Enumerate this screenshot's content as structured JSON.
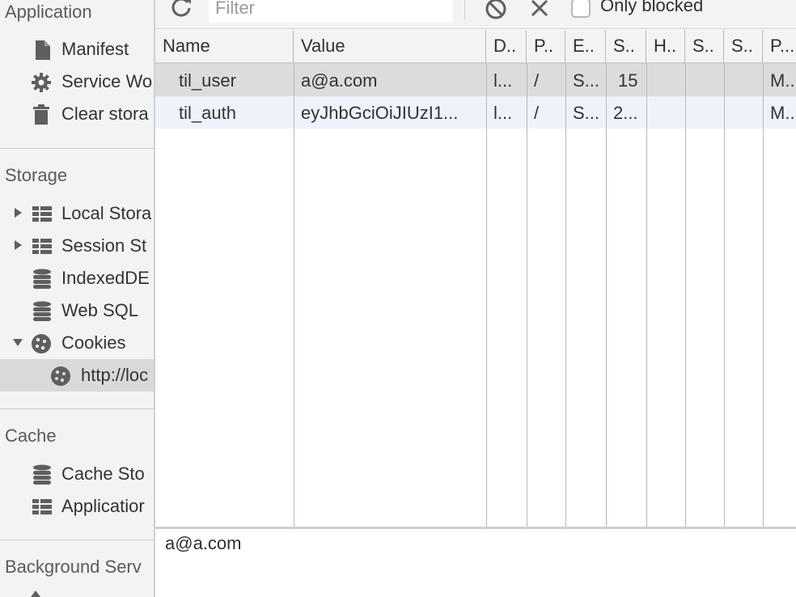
{
  "sidebar": {
    "application": {
      "header": "Application",
      "items": [
        {
          "label": "Manifest",
          "icon": "document-icon"
        },
        {
          "label": "Service Wo",
          "icon": "gear-icon"
        },
        {
          "label": "Clear stora",
          "icon": "trash-icon"
        }
      ]
    },
    "storage": {
      "header": "Storage",
      "items": [
        {
          "label": "Local Stora",
          "icon": "grid-icon"
        },
        {
          "label": "Session St",
          "icon": "grid-icon"
        },
        {
          "label": "IndexedDE",
          "icon": "database-icon"
        },
        {
          "label": "Web SQL",
          "icon": "database-icon"
        },
        {
          "label": "Cookies",
          "icon": "cookie-icon"
        },
        {
          "label": "http://loc",
          "icon": "cookie-icon"
        }
      ]
    },
    "cache": {
      "header": "Cache",
      "items": [
        {
          "label": "Cache Sto",
          "icon": "database-icon"
        },
        {
          "label": "Applicatior",
          "icon": "grid-icon"
        }
      ]
    },
    "background": {
      "header": "Background Serv"
    }
  },
  "toolbar": {
    "filter_placeholder": "Filter",
    "only_blocked_label": "Only blocked"
  },
  "table": {
    "columns": [
      "Name",
      "Value",
      "D..",
      "P..",
      "E..",
      "S..",
      "H..",
      "S..",
      "S..",
      "P..."
    ],
    "rows": [
      [
        "til_user",
        "a@a.com",
        "l...",
        "/",
        "S...",
        "15",
        "",
        "",
        "",
        "M..."
      ],
      [
        "til_auth",
        "eyJhbGciOiJIUzI1...",
        "l...",
        "/",
        "S...",
        "2...",
        "",
        "",
        "",
        "M..."
      ]
    ]
  },
  "preview": {
    "value": "a@a.com"
  },
  "colors": {
    "selected_row": "#dcdcdc",
    "alt_row": "#eef3fb",
    "sidebar_bg": "#f3f3f3"
  }
}
